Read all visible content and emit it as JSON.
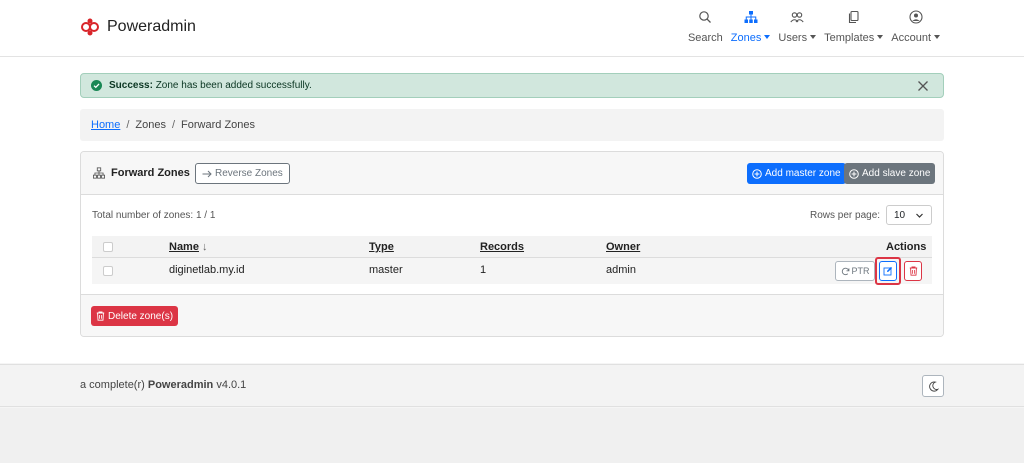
{
  "header": {
    "brand": "Poweradmin",
    "nav": [
      {
        "label": "Search",
        "icon": "search-icon",
        "dropdown": false,
        "active": false
      },
      {
        "label": "Zones",
        "icon": "sitemap-icon",
        "dropdown": true,
        "active": true
      },
      {
        "label": "Users",
        "icon": "users-icon",
        "dropdown": true,
        "active": false
      },
      {
        "label": "Templates",
        "icon": "copy-icon",
        "dropdown": true,
        "active": false
      },
      {
        "label": "Account",
        "icon": "user-circle-icon",
        "dropdown": true,
        "active": false
      }
    ]
  },
  "alert": {
    "strong": "Success:",
    "message": "Zone has been added successfully."
  },
  "breadcrumb": {
    "home": "Home",
    "sep": "/",
    "zones": "Zones",
    "current": "Forward Zones"
  },
  "card": {
    "title": "Forward Zones",
    "reverse_button": "Reverse Zones",
    "add_master_button": "Add master zone",
    "add_slave_button": "Add slave zone",
    "total": "Total number of zones: 1 / 1",
    "rows_per_page_label": "Rows per page:",
    "rows_per_page_value": "10",
    "columns": {
      "name": "Name",
      "sort_arrow": "↓",
      "type": "Type",
      "records": "Records",
      "owner": "Owner",
      "actions": "Actions"
    },
    "rows": [
      {
        "name": "diginetlab.my.id",
        "type": "master",
        "records": "1",
        "owner": "admin"
      }
    ],
    "ptr_button": "PTR",
    "delete_button": "Delete zone(s)"
  },
  "footer": {
    "prefix": "a complete(r)",
    "name": "Poweradmin",
    "version": "v4.0.1"
  },
  "colors": {
    "primary": "#0d6efd",
    "secondary": "#6c757d",
    "danger": "#dc3545",
    "success_bg": "#d1e7dd",
    "brand": "#d9252a"
  }
}
